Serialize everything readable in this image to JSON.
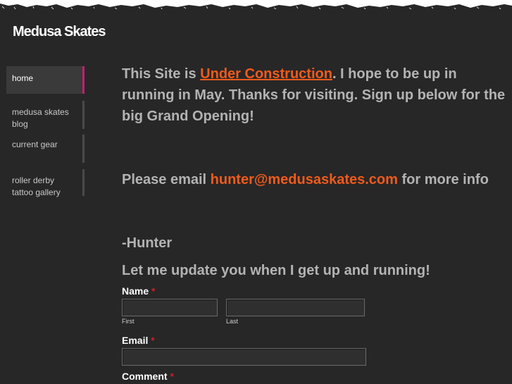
{
  "site": {
    "title": "Medusa Skates"
  },
  "nav": {
    "items": [
      {
        "label": "home",
        "active": true
      },
      {
        "label": "medusa skates blog"
      },
      {
        "label": "current gear"
      },
      {
        "label": "roller derby tattoo gallery"
      }
    ]
  },
  "content": {
    "lead_prefix": "This Site is ",
    "lead_link": "Under Construction",
    "lead_suffix": ".  I hope to be up in running in May.  Thanks for visiting.  Sign up below for the big Grand Opening!",
    "email_prefix": "Please email ",
    "email_link": "hunter@medusaskates.com",
    "email_suffix": " for more info",
    "signature": "-Hunter"
  },
  "form": {
    "heading": "Let me update you when I get up and running!",
    "name_label": "Name",
    "required_mark": "*",
    "first_sublabel": "First",
    "last_sublabel": "Last",
    "first_value": "",
    "last_value": "",
    "email_label": "Email",
    "email_value": "",
    "comment_label": "Comment"
  },
  "colors": {
    "background": "#272727",
    "accent_link": "#f05a1c",
    "active_nav_bar": "#c4206f",
    "required": "#c8202a"
  }
}
